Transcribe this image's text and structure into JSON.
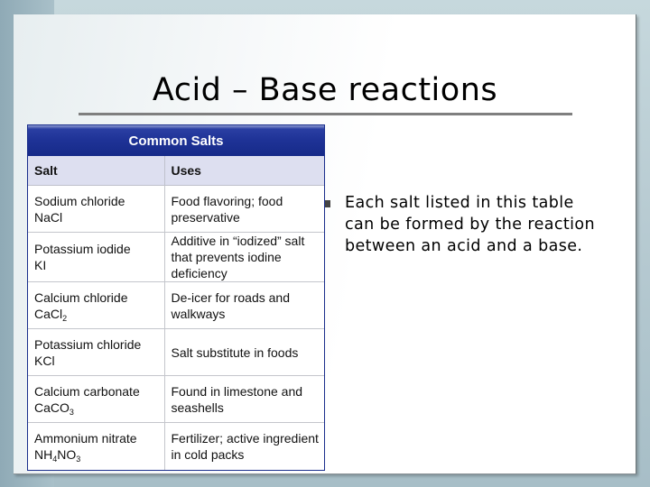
{
  "slide": {
    "title": "Acid – Base reactions",
    "bullets": [
      "Each salt listed in this table can be formed by the reaction between an acid and a base."
    ]
  },
  "table": {
    "caption": "Common Salts",
    "headers": [
      "Salt",
      "Uses"
    ],
    "rows": [
      {
        "name": "Sodium chloride",
        "formula": [
          "NaCl"
        ],
        "use": "Food flavoring; food preservative"
      },
      {
        "name": "Potassium iodide",
        "formula": [
          "KI"
        ],
        "use": "Additive in “iodized” salt that prevents iodine deficiency"
      },
      {
        "name": "Calcium chloride",
        "formula": [
          "CaCl",
          "2"
        ],
        "use": "De-icer for roads and walkways"
      },
      {
        "name": "Potassium chloride",
        "formula": [
          "KCl"
        ],
        "use": "Salt substitute in foods"
      },
      {
        "name": "Calcium carbonate",
        "formula": [
          "CaCO",
          "3"
        ],
        "use": "Found in limestone and seashells"
      },
      {
        "name": "Ammonium nitrate",
        "formula": [
          "NH",
          "4",
          "NO",
          "3"
        ],
        "use": "Fertilizer; active ingredient in cold packs"
      }
    ]
  },
  "colors": {
    "table_header": "#1e3296",
    "column_header_bg": "#dddff0",
    "title_rule": "#7f7f7f"
  }
}
